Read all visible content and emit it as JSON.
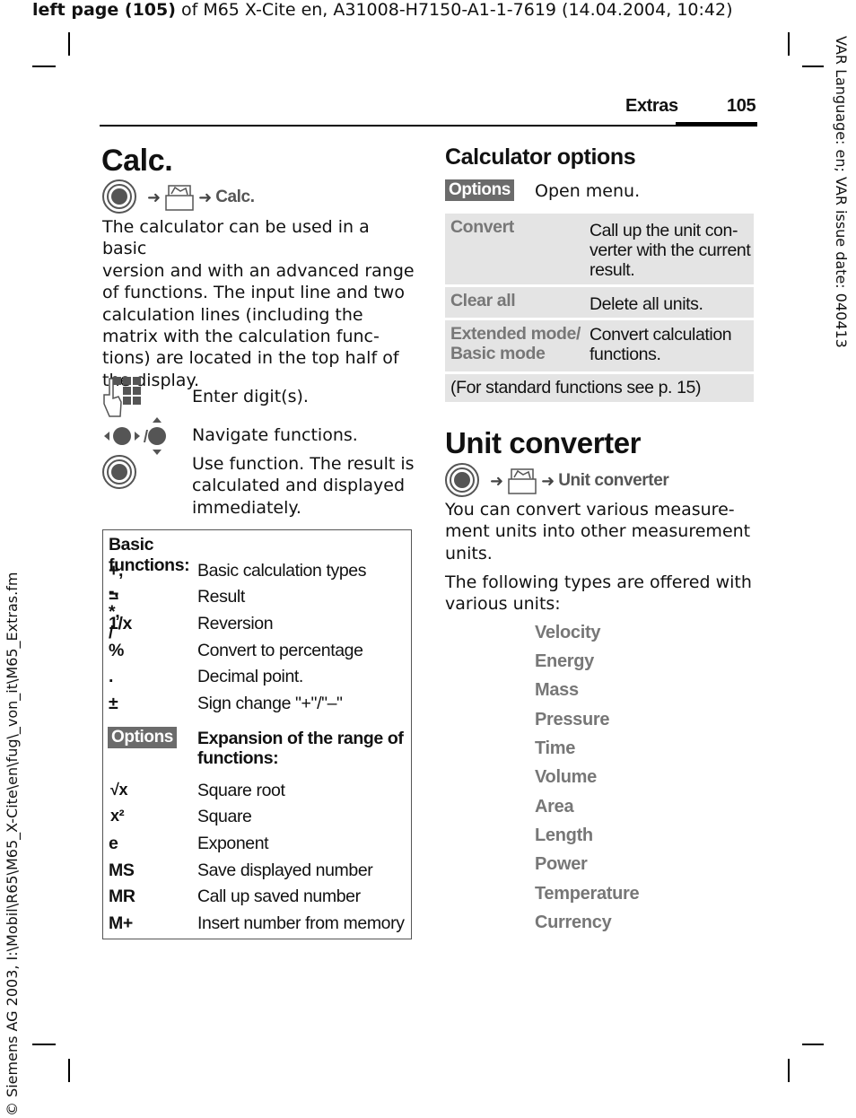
{
  "header": {
    "prefix": "left page (105)",
    "rest": " of M65 X-Cite en, A31008-H7150-A1-1-7619 (14.04.2004, 10:42)"
  },
  "side_right": "VAR Language: en; VAR issue date: 040413",
  "side_left": "© Siemens AG 2003, I:\\Mobil\\R65\\M65_X-Cite\\en\\fug\\_von_it\\M65_Extras.fm",
  "running_head": {
    "section": "Extras",
    "page": "105"
  },
  "calc": {
    "title": "Calc.",
    "path_label": "Calc.",
    "intro": "The calculator can be used in a basic version and with an advanced range of functions. The input line and two calculation lines (including the matrix with the calculation functions) are located in the top half of the display.",
    "intro_lines": [
      "The calculator can be used in a basic",
      "version and with an advanced range",
      "of functions. The input line and two",
      "calculation lines (including the",
      "matrix with the calculation func-",
      "tions) are located in the top half of",
      "the display."
    ],
    "keys": [
      {
        "icon": "keypad-icon",
        "text": "Enter digit(s)."
      },
      {
        "icon": "navigation-key-icon",
        "text": "Navigate functions."
      },
      {
        "icon": "center-key-icon",
        "text_lines": [
          "Use function. The result is",
          "calculated and displayed",
          "immediately."
        ]
      }
    ],
    "table": {
      "heading": "Basic functions:",
      "basic": [
        {
          "key": "+, -, *, /",
          "desc": "Basic calculation types"
        },
        {
          "key": "=",
          "desc": "Result"
        },
        {
          "key": "1/x",
          "desc": "Reversion"
        },
        {
          "key": "%",
          "desc": "Convert to percentage"
        },
        {
          "key": ".",
          "desc": "Decimal point."
        },
        {
          "key": "±",
          "desc": "Sign change \"+\"/\"–\""
        }
      ],
      "options_badge": "Options",
      "expansion_lines": [
        "Expansion of the range of",
        "functions:"
      ],
      "extended": [
        {
          "key": "√x",
          "desc": "Square root"
        },
        {
          "key": "x²",
          "desc": "Square"
        },
        {
          "key": "e",
          "desc": "Exponent"
        },
        {
          "key": "MS",
          "desc": "Save displayed number"
        },
        {
          "key": "MR",
          "desc": "Call up saved number"
        },
        {
          "key": "M+",
          "desc": "Insert number from memory"
        }
      ]
    }
  },
  "calc_options": {
    "title": "Calculator options",
    "options_badge": "Options",
    "open_menu": "Open menu.",
    "rows": [
      {
        "key_lines": [
          "Convert"
        ],
        "desc_lines": [
          "Call up the unit  con-",
          "verter with the current",
          "result."
        ]
      },
      {
        "key_lines": [
          "Clear all"
        ],
        "desc_lines": [
          "Delete all units."
        ]
      },
      {
        "key_lines": [
          "Extended mode/",
          "Basic mode"
        ],
        "desc_lines": [
          "Convert calculation",
          "functions."
        ]
      }
    ],
    "footnote": "(For standard functions see p. 15)"
  },
  "unit_converter": {
    "title": "Unit converter",
    "path_label": "Unit converter",
    "para1_lines": [
      "You can convert various measure-",
      "ment units into other measurement",
      "units."
    ],
    "para2_lines": [
      "The following types are offered with",
      "various units:"
    ],
    "types": [
      "Velocity",
      "Energy",
      "Mass",
      "Pressure",
      "Time",
      "Volume",
      "Area",
      "Length",
      "Power",
      "Temperature",
      "Currency"
    ]
  },
  "colors": {
    "badge": "#6b6b6b",
    "menu_label": "#777777",
    "table_bg": "#e4e4e4"
  }
}
